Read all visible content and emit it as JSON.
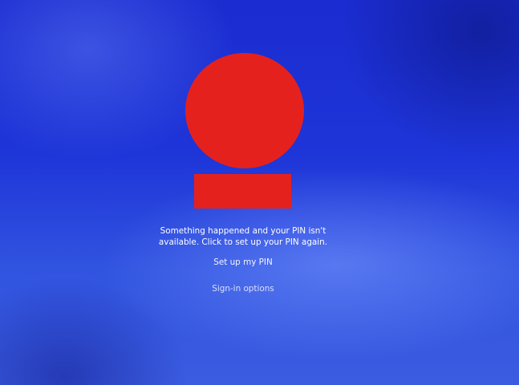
{
  "lock_screen": {
    "message_line1": "Something happened and your PIN isn't",
    "message_line2": "available. Click to set up your PIN again.",
    "setup_pin_link": "Set up my PIN",
    "signin_options_link": "Sign-in options"
  },
  "colors": {
    "redaction": "#e5211e",
    "background": "#1e35d8",
    "text": "#ffffff"
  }
}
